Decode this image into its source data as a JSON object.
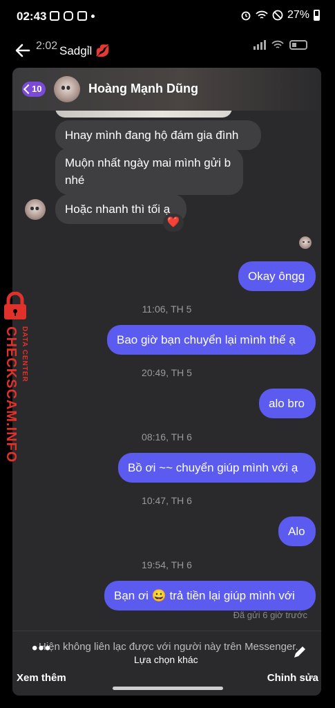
{
  "status_bar": {
    "time": "02:43",
    "battery": "27%"
  },
  "story_header": {
    "time": "2:02",
    "name": "Sadgỉl 💋"
  },
  "chat": {
    "contact_name": "Hoàng Mạnh Dũng",
    "unread_count": "10",
    "messages": [
      {
        "dir": "in",
        "text": "Hnay mình đang hộ đám gia đình"
      },
      {
        "dir": "in",
        "text": "Muộn nhất ngày mai mình gửi b nhé"
      },
      {
        "dir": "in",
        "text": "Hoặc nhanh thì tối ạ",
        "reaction": "❤️"
      },
      {
        "dir": "out",
        "text": "Okay ôngg"
      },
      {
        "dir": "ts",
        "text": "11:06, TH 5"
      },
      {
        "dir": "out",
        "text": "Bao giờ bạn chuyển lại mình thế ạ"
      },
      {
        "dir": "ts",
        "text": "20:49, TH 5"
      },
      {
        "dir": "out",
        "text": "alo bro"
      },
      {
        "dir": "ts",
        "text": "08:16, TH 6"
      },
      {
        "dir": "out",
        "text": "Bồ ơi ~~ chuyển giúp mình với ạ"
      },
      {
        "dir": "ts",
        "text": "10:47, TH 6"
      },
      {
        "dir": "out",
        "text": "Alo"
      },
      {
        "dir": "ts",
        "text": "19:54, TH 6"
      },
      {
        "dir": "out",
        "text": "Bạn ơi 😀 trả tiền lại giúp mình với"
      }
    ],
    "sent_status": "Đã gửi 6 giờ trước",
    "notice": "Hiện không liên lạc được với người này trên Messenger.",
    "other_option": "Lựa chọn khác"
  },
  "bottom_bar": {
    "more_label": "Xem thêm",
    "edit_label": "Chỉnh sửa"
  },
  "watermark": {
    "main": "CHECKSCAM.INFO",
    "sub": "DATA CENTER",
    "color": "#e0312b"
  },
  "colors": {
    "outgoing": "#5b5bf0",
    "incoming": "#3f3f42",
    "accent": "#7b4ad8"
  }
}
